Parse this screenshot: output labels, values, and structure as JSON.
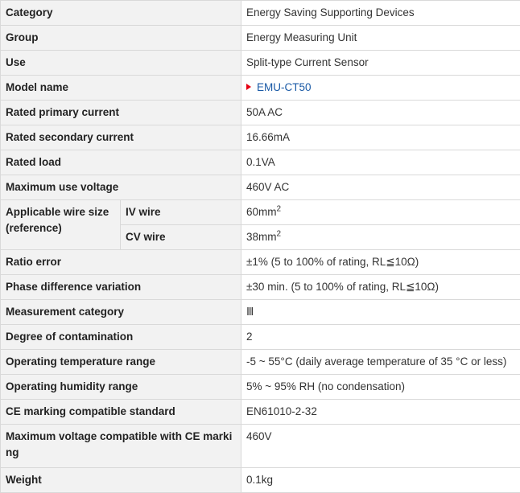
{
  "rows": {
    "category": {
      "label": "Category",
      "value": "Energy Saving Supporting Devices"
    },
    "group": {
      "label": "Group",
      "value": "Energy Measuring Unit"
    },
    "use": {
      "label": "Use",
      "value": "Split-type Current Sensor"
    },
    "model_name": {
      "label": "Model name",
      "value": "EMU-CT50",
      "icon": "arrow-right-icon",
      "icon_color": "#e60012",
      "link_color": "#1a5aa6"
    },
    "rated_primary_current": {
      "label": "Rated primary current",
      "value": "50A AC"
    },
    "rated_secondary_current": {
      "label": "Rated secondary current",
      "value": "16.66mA"
    },
    "rated_load": {
      "label": "Rated load",
      "value": "0.1VA"
    },
    "maximum_use_voltage": {
      "label": "Maximum use voltage",
      "value": "460V AC"
    },
    "applicable_wire_size": {
      "label": "Applicable wire size (reference)",
      "iv": {
        "label": "IV wire",
        "value": "60mm",
        "sup": "2"
      },
      "cv": {
        "label": "CV wire",
        "value": "38mm",
        "sup": "2"
      }
    },
    "ratio_error": {
      "label": "Ratio error",
      "value": "±1% (5 to 100% of rating, RL≦10Ω)"
    },
    "phase_difference_variation": {
      "label": "Phase difference variation",
      "value": "±30 min. (5 to 100% of rating, RL≦10Ω)"
    },
    "measurement_category": {
      "label": "Measurement category",
      "value": "Ⅲ"
    },
    "degree_of_contamination": {
      "label": "Degree of contamination",
      "value": "2"
    },
    "operating_temperature_range": {
      "label": "Operating temperature range",
      "value": "-5 ~ 55°C (daily average temperature of 35 °C or less)"
    },
    "operating_humidity_range": {
      "label": "Operating humidity range",
      "value": "5% ~ 95% RH (no condensation)"
    },
    "ce_marking_standard": {
      "label": "CE marking compatible standard",
      "value": "EN61010-2-32"
    },
    "max_voltage_ce": {
      "label": "Maximum voltage compatible with CE marking",
      "value": "460V"
    },
    "weight": {
      "label": "Weight",
      "value": "0.1kg"
    }
  },
  "colors": {
    "header_bg": "#f2f2f2",
    "border": "#d9d9d9",
    "link": "#1a5aa6",
    "accent_red": "#e60012"
  }
}
